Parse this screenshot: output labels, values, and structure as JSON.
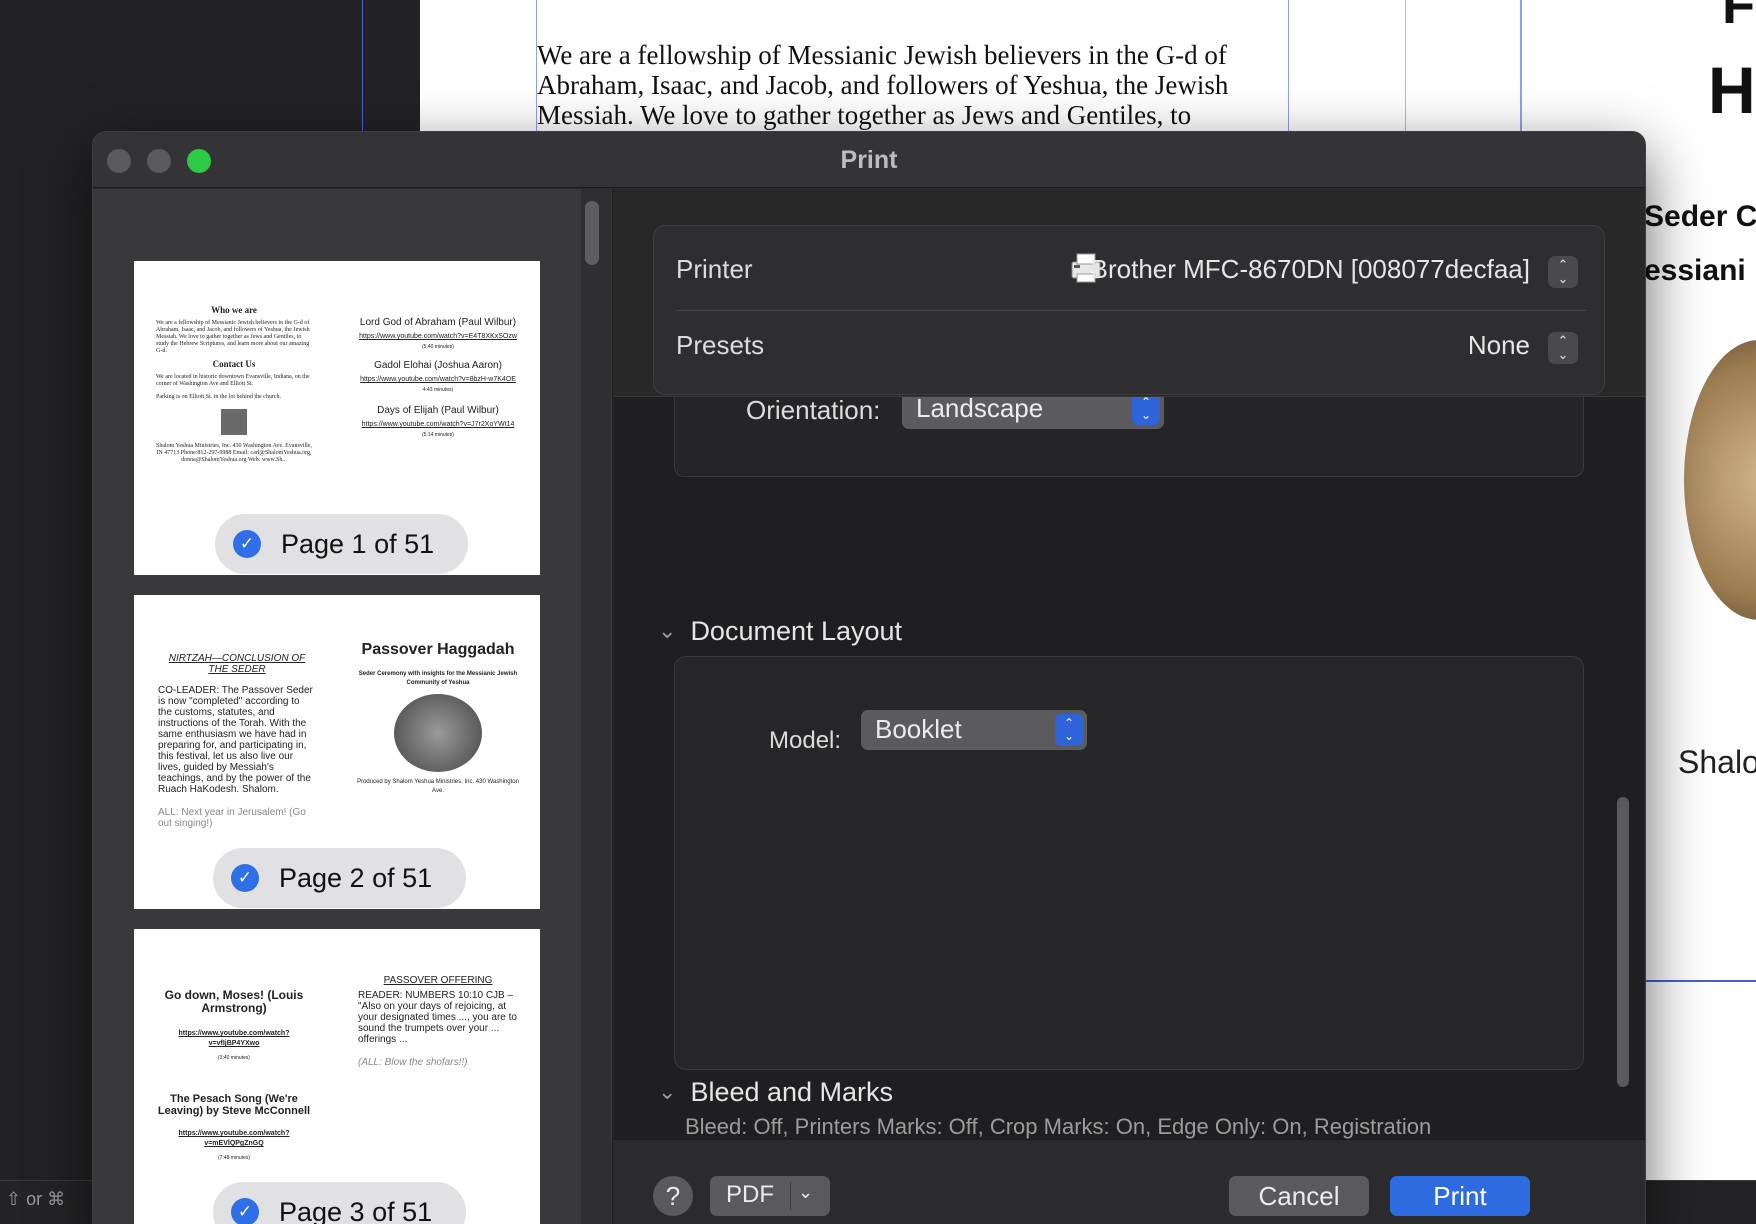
{
  "background": {
    "doc_text": "We are a fellowship of Messianic Jewish believers in the G-d of Abraham, Isaac, and Jacob, and followers of Yeshua, the Jewish Messiah. We love to gather together as Jews and Gentiles, to",
    "right_big_1": "F",
    "right_big_2": "H",
    "right_line_1": "Seder C",
    "right_line_2": "essiani",
    "right_shalo": "Shalo",
    "status_text": "⇧ or ⌘"
  },
  "dialog": {
    "title": "Print"
  },
  "preview": {
    "pages": [
      {
        "label": "Page 1 of 51",
        "left": {
          "h1": "Who we are",
          "p1": "We are a fellowship of Messianic Jewish believers in the G-d of Abraham, Isaac, and Jacob, and followers of Yeshua, the Jewish Messiah. We love to gather together as Jews and Gentiles, to study the Hebrew Scriptures, and learn more about our amazing G-d.",
          "h2": "Contact Us",
          "p2": "We are located in historic downtown Evansville, Indiana, on the corner of Washington Ave and Elliott St.",
          "p3": "Parking is on Elliott St. in the lot behind the church.",
          "p4": "Shalom Yeshua Ministries, Inc. 430 Washington Ave. Evansville, IN 47713 Phone:812-297-9988 Email: carl@ShalomYeshua.org, donna@ShalomYeshua.org Web: www.Sh..."
        },
        "right": {
          "s1": "Lord God of Abraham (Paul Wilbur)",
          "l1": "https://www.youtube.com/watch?v=E4T8XKxSOzw",
          "m1": "(5:40 minutes)",
          "s2": "Gadol Elohai (Joshua Aaron)",
          "l2": "https://www.youtube.com/watch?v=8bzH-w7K4OE",
          "m2": "4:43 minutes)",
          "s3": "Days of Elijah (Paul Wilbur)",
          "l3": "https://www.youtube.com/watch?v=J7r2XoYWt14",
          "m3": "(5:14 minutes)"
        }
      },
      {
        "label": "Page 2 of 51",
        "left": {
          "h1": "NIRTZAH—CONCLUSION OF THE SEDER",
          "p1": "CO-LEADER: The Passover Seder is now \"completed\" according to the customs, statutes, and instructions of the Torah. With the same enthusiasm we have had in preparing for, and participating in, this festival, let us also live our lives, guided by Messiah's teachings, and by the power of the Ruach HaKodesh. Shalom.",
          "p2": "ALL: Next year in Jerusalem! (Go out singing!)"
        },
        "right": {
          "title": "Passover Haggadah",
          "sub": "Seder Ceremony with insights for the Messianic Jewish Community of Yeshua",
          "prod": "Produced by Shalom Yeshua Ministries, Inc. 430 Washington Ave."
        }
      },
      {
        "label": "Page 3 of 51",
        "left": {
          "s1": "Go down, Moses! (Louis Armstrong)",
          "l1": "https://www.youtube.com/watch?v=vfIjBP4YXwo",
          "m1": "(3:40 minutes)",
          "s2": "The Pesach Song (We're Leaving) by Steve McConnell",
          "l2": "https://www.youtube.com/watch?v=mEVlQPgZnGQ",
          "m2": "(7:48 minutes)"
        },
        "right": {
          "h1": "PASSOVER OFFERING",
          "p1": "READER: NUMBERS 10:10 CJB – \"Also on your days of rejoicing, at your designated times ..., you are to sound the trumpets over your ... offerings ...",
          "p2": "(ALL: Blow the shofars!!)"
        }
      }
    ]
  },
  "settings": {
    "printer_label": "Printer",
    "printer_value": "Brother MFC-8670DN [008077decfaa]",
    "presets_label": "Presets",
    "presets_value": "None",
    "orientation_label": "Orientation:",
    "orientation_value": "Landscape",
    "document_layout_heading": "Document Layout",
    "model_label": "Model:",
    "model_value": "Booklet",
    "bleed_heading": "Bleed and Marks",
    "bleed_summary": "Bleed: Off, Printers Marks: Off, Crop Marks: On, Edge Only: On, Registration"
  },
  "footer": {
    "help_label": "?",
    "pdf_label": "PDF",
    "cancel_label": "Cancel",
    "print_label": "Print"
  },
  "colors": {
    "accent": "#2f6be0",
    "window_traffic_green": "#2ec945"
  },
  "icons": {
    "printer": "printer-icon",
    "check": "checkmark-circle-icon",
    "stepper": "up-down-chevron-icon",
    "disclosure": "chevron-down-icon"
  }
}
